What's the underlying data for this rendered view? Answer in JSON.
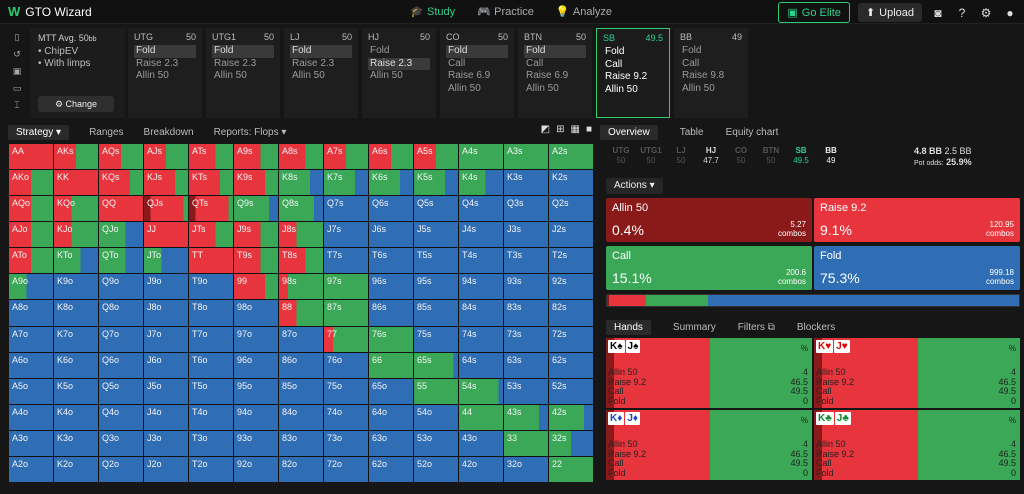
{
  "nav": {
    "app_title": "GTO Wizard",
    "logo_letter": "W",
    "items": [
      {
        "label": "Study",
        "icon": "graduation-cap-icon",
        "active": true
      },
      {
        "label": "Practice",
        "icon": "gamepad-icon",
        "active": false
      },
      {
        "label": "Analyze",
        "icon": "lightbulb-icon",
        "active": false
      }
    ],
    "elite_label": "Go Elite",
    "upload_label": "Upload"
  },
  "spot": {
    "format": "MTT",
    "avg": "Avg. 50",
    "avg_unit": "bb",
    "options": [
      "• ChipEV",
      "• With limps"
    ],
    "change_label": "Change"
  },
  "positions": [
    {
      "name": "UTG",
      "stack": "50",
      "actions": [
        "Fold",
        "Raise 2.3",
        "Allin 50"
      ],
      "selected": 0
    },
    {
      "name": "UTG1",
      "stack": "50",
      "actions": [
        "Fold",
        "Raise 2.3",
        "Allin 50"
      ],
      "selected": 0
    },
    {
      "name": "LJ",
      "stack": "50",
      "actions": [
        "Fold",
        "Raise 2.3",
        "Allin 50"
      ],
      "selected": 0
    },
    {
      "name": "HJ",
      "stack": "50",
      "actions": [
        "Fold",
        "Raise 2.3",
        "Allin 50"
      ],
      "selected": 1
    },
    {
      "name": "CO",
      "stack": "50",
      "actions": [
        "Fold",
        "Call",
        "Raise 6.9",
        "Allin 50"
      ],
      "selected": 0
    },
    {
      "name": "BTN",
      "stack": "50",
      "actions": [
        "Fold",
        "Call",
        "Raise 6.9",
        "Allin 50"
      ],
      "selected": 0
    },
    {
      "name": "SB",
      "stack": "49.5",
      "actions": [
        "Fold",
        "Call",
        "Raise 9.2",
        "Allin 50"
      ],
      "selected": -1,
      "active": true
    },
    {
      "name": "BB",
      "stack": "49",
      "actions": [
        "Fold",
        "Call",
        "Raise 9.8",
        "Allin 50"
      ],
      "selected": -1
    }
  ],
  "left_tabs": [
    "Strategy",
    "Ranges",
    "Breakdown",
    "Reports: Flops"
  ],
  "grid_colors": {
    "allin": "#8a1a1a",
    "raise": "#e8343d",
    "call": "#3aa857",
    "fold": "#2f6db5"
  },
  "grid": [
    [
      "AA",
      "AKs",
      "AQs",
      "AJs",
      "ATs",
      "A9s",
      "A8s",
      "A7s",
      "A6s",
      "A5s",
      "A4s",
      "A3s",
      "A2s"
    ],
    [
      "AKo",
      "KK",
      "KQs",
      "KJs",
      "KTs",
      "K9s",
      "K8s",
      "K7s",
      "K6s",
      "K5s",
      "K4s",
      "K3s",
      "K2s"
    ],
    [
      "AQo",
      "KQo",
      "QQ",
      "QJs",
      "QTs",
      "Q9s",
      "Q8s",
      "Q7s",
      "Q6s",
      "Q5s",
      "Q4s",
      "Q3s",
      "Q2s"
    ],
    [
      "AJo",
      "KJo",
      "QJo",
      "JJ",
      "JTs",
      "J9s",
      "J8s",
      "J7s",
      "J6s",
      "J5s",
      "J4s",
      "J3s",
      "J2s"
    ],
    [
      "ATo",
      "KTo",
      "QTo",
      "JTo",
      "TT",
      "T9s",
      "T8s",
      "T7s",
      "T6s",
      "T5s",
      "T4s",
      "T3s",
      "T2s"
    ],
    [
      "A9o",
      "K9o",
      "Q9o",
      "J9o",
      "T9o",
      "99",
      "98s",
      "97s",
      "96s",
      "95s",
      "94s",
      "93s",
      "92s"
    ],
    [
      "A8o",
      "K8o",
      "Q8o",
      "J8o",
      "T8o",
      "98o",
      "88",
      "87s",
      "86s",
      "85s",
      "84s",
      "83s",
      "82s"
    ],
    [
      "A7o",
      "K7o",
      "Q7o",
      "J7o",
      "T7o",
      "97o",
      "87o",
      "77",
      "76s",
      "75s",
      "74s",
      "73s",
      "72s"
    ],
    [
      "A6o",
      "K6o",
      "Q6o",
      "J6o",
      "T6o",
      "96o",
      "86o",
      "76o",
      "66",
      "65s",
      "64s",
      "63s",
      "62s"
    ],
    [
      "A5o",
      "K5o",
      "Q5o",
      "J5o",
      "T5o",
      "95o",
      "85o",
      "75o",
      "65o",
      "55",
      "54s",
      "53s",
      "52s"
    ],
    [
      "A4o",
      "K4o",
      "Q4o",
      "J4o",
      "T4o",
      "94o",
      "84o",
      "74o",
      "64o",
      "54o",
      "44",
      "43s",
      "42s"
    ],
    [
      "A3o",
      "K3o",
      "Q3o",
      "J3o",
      "T3o",
      "93o",
      "83o",
      "73o",
      "63o",
      "53o",
      "43o",
      "33",
      "32s"
    ],
    [
      "A2o",
      "K2o",
      "Q2o",
      "J2o",
      "T2o",
      "92o",
      "82o",
      "72o",
      "62o",
      "52o",
      "42o",
      "32o",
      "22"
    ]
  ],
  "right_tabs": [
    "Overview",
    "Table",
    "Equity chart"
  ],
  "pos_summary": [
    {
      "name": "UTG",
      "stack": "50",
      "state": "fold"
    },
    {
      "name": "UTG1",
      "stack": "50",
      "state": "fold"
    },
    {
      "name": "LJ",
      "stack": "50",
      "state": "fold"
    },
    {
      "name": "HJ",
      "stack": "47.7",
      "state": "hj"
    },
    {
      "name": "CO",
      "stack": "50",
      "state": "fold"
    },
    {
      "name": "BTN",
      "stack": "50",
      "state": "fold"
    },
    {
      "name": "SB",
      "stack": "49.5",
      "state": "sb"
    },
    {
      "name": "BB",
      "stack": "49",
      "state": "bb"
    }
  ],
  "pot": {
    "bb": "4.8 BB",
    "to_call": "2.5 BB",
    "pot_odds_label": "Pot odds:",
    "pot_odds": "25.9%"
  },
  "actions_label": "Actions",
  "actions": [
    {
      "name": "Allin 50",
      "pct": "0.4%",
      "combos": "5.27",
      "combos_label": "combos",
      "color": "#8a1a1a"
    },
    {
      "name": "Raise 9.2",
      "pct": "9.1%",
      "combos": "120.95",
      "combos_label": "combos",
      "color": "#e8343d"
    },
    {
      "name": "Call",
      "pct": "15.1%",
      "combos": "200.6",
      "combos_label": "combos",
      "color": "#3aa857"
    },
    {
      "name": "Fold",
      "pct": "75.3%",
      "combos": "999.18",
      "combos_label": "combos",
      "color": "#2f6db5"
    }
  ],
  "hand_tabs": [
    "Hands",
    "Summary",
    "Filters",
    "Blockers"
  ],
  "hands": [
    {
      "cards": [
        {
          "r": "K",
          "s": "♠",
          "c": "black"
        },
        {
          "r": "J",
          "s": "♠",
          "c": "black"
        }
      ],
      "pct_label": "%",
      "rows": [
        [
          "Allin 50",
          "4"
        ],
        [
          "Raise 9.2",
          "46.5"
        ],
        [
          "Call",
          "49.5"
        ],
        [
          "Fold",
          "0"
        ]
      ]
    },
    {
      "cards": [
        {
          "r": "K",
          "s": "♥",
          "c": "red"
        },
        {
          "r": "J",
          "s": "♥",
          "c": "red"
        }
      ],
      "pct_label": "%",
      "rows": [
        [
          "Allin 50",
          "4"
        ],
        [
          "Raise 9.2",
          "46.5"
        ],
        [
          "Call",
          "49.5"
        ],
        [
          "Fold",
          "0"
        ]
      ]
    },
    {
      "cards": [
        {
          "r": "K",
          "s": "♦",
          "c": "blue"
        },
        {
          "r": "J",
          "s": "♦",
          "c": "blue"
        }
      ],
      "pct_label": "%",
      "rows": [
        [
          "Allin 50",
          "4"
        ],
        [
          "Raise 9.2",
          "46.5"
        ],
        [
          "Call",
          "49.5"
        ],
        [
          "Fold",
          "0"
        ]
      ]
    },
    {
      "cards": [
        {
          "r": "K",
          "s": "♣",
          "c": "green"
        },
        {
          "r": "J",
          "s": "♣",
          "c": "green"
        }
      ],
      "pct_label": "%",
      "rows": [
        [
          "Allin 50",
          "4"
        ],
        [
          "Raise 9.2",
          "46.5"
        ],
        [
          "Call",
          "49.5"
        ],
        [
          "Fold",
          "0"
        ]
      ]
    }
  ]
}
